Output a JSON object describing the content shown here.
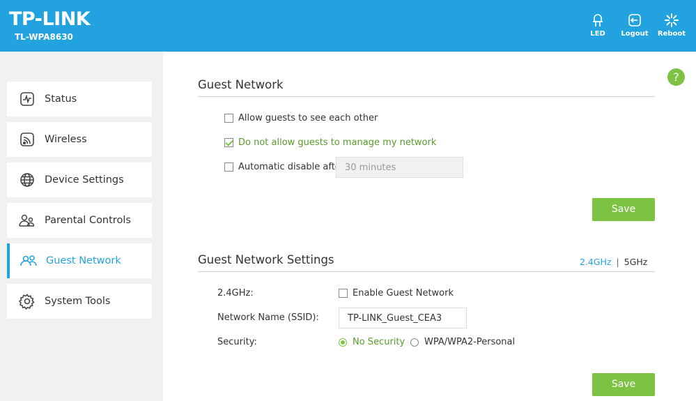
{
  "header": {
    "brand": "TP-LINK",
    "model": "TL-WPA8630",
    "buttons": {
      "led": "LED",
      "logout": "Logout",
      "reboot": "Reboot"
    }
  },
  "sidebar": {
    "items": [
      {
        "label": "Status",
        "icon": "status-icon"
      },
      {
        "label": "Wireless",
        "icon": "wireless-icon"
      },
      {
        "label": "Device Settings",
        "icon": "globe-icon"
      },
      {
        "label": "Parental Controls",
        "icon": "parental-controls-icon"
      },
      {
        "label": "Guest Network",
        "icon": "guest-network-icon",
        "active": true
      },
      {
        "label": "System Tools",
        "icon": "gear-icon"
      }
    ]
  },
  "help": "?",
  "guest_network": {
    "title": "Guest Network",
    "allow_see_each_other": {
      "label": "Allow guests to see each other",
      "checked": false
    },
    "no_manage": {
      "label": "Do not allow guests to manage my network",
      "checked": true
    },
    "auto_disable": {
      "label": "Automatic disable after",
      "checked": false,
      "value": "30 minutes"
    },
    "save_label": "Save"
  },
  "guest_settings": {
    "title": "Guest Network Settings",
    "freq": {
      "a": "2.4GHz",
      "sep": "|",
      "b": "5GHz",
      "selected": "2.4GHz"
    },
    "band_label": "2.4GHz:",
    "enable_label": "Enable Guest Network",
    "ssid_label": "Network Name (SSID):",
    "ssid_value": "TP-LINK_Guest_CEA3",
    "security_label": "Security:",
    "security_options": {
      "none": "No Security",
      "wpa": "WPA/WPA2-Personal"
    },
    "security_selected": "No Security",
    "save_label": "Save"
  },
  "colors": {
    "header": "#22a3e0",
    "accent": "#22a3e0",
    "green": "#7dc242"
  }
}
